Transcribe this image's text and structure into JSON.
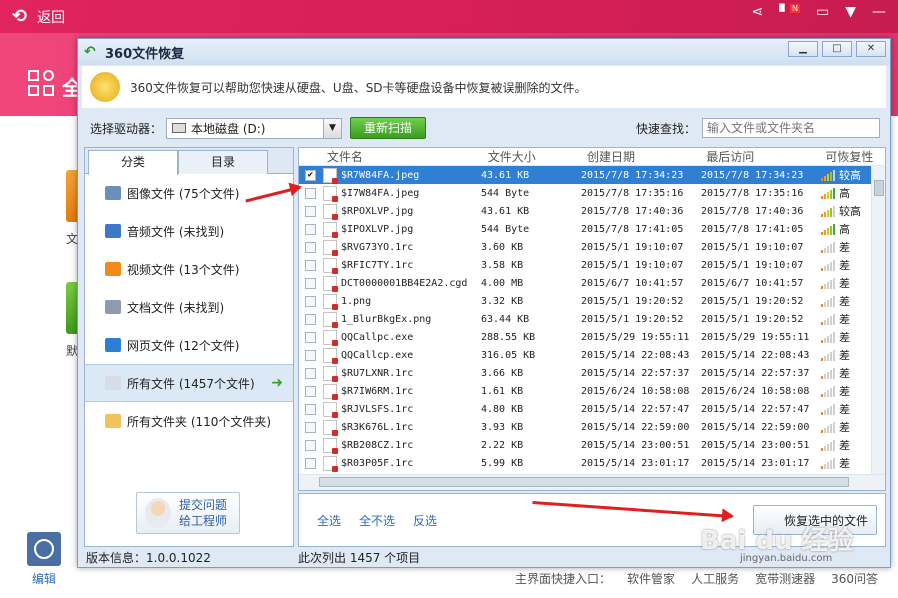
{
  "bg": {
    "back_label": "返回",
    "tile_char": "全",
    "left_item1_char": "文",
    "left_item2_char": "默",
    "edit_label": "编辑",
    "notif_badge": "N",
    "bottom_links": [
      "主界面快捷入口：",
      "软件管家",
      "人工服务",
      "宽带测速器",
      "360问答"
    ]
  },
  "window": {
    "title": "360文件恢复",
    "info_text": "360文件恢复可以帮助您快速从硬盘、U盘、SD卡等硬盘设备中恢复被误删除的文件。",
    "drive_label": "选择驱动器：",
    "drive_value": "本地磁盘 (D:)",
    "rescan_label": "重新扫描",
    "search_label": "快速查找：",
    "search_placeholder": "输入文件或文件夹名"
  },
  "left": {
    "tabs": [
      "分类",
      "目录"
    ],
    "categories": [
      {
        "label": "图像文件 (75个文件)",
        "icon": "image-icon",
        "color": "#6a8fb8"
      },
      {
        "label": "音频文件 (未找到)",
        "icon": "music-icon",
        "color": "#3f78c4"
      },
      {
        "label": "视频文件 (13个文件)",
        "icon": "video-icon",
        "color": "#f08a1c"
      },
      {
        "label": "文档文件 (未找到)",
        "icon": "document-icon",
        "color": "#8c9bb0"
      },
      {
        "label": "网页文件 (12个文件)",
        "icon": "ie-icon",
        "color": "#2d7fd6"
      },
      {
        "label": "所有文件 (1457个文件)",
        "icon": "all-files-icon",
        "color": "#d6dde6"
      },
      {
        "label": "所有文件夹 (110个文件夹)",
        "icon": "folder-icon",
        "color": "#f2c35a"
      }
    ],
    "feedback_line1": "提交问题",
    "feedback_line2": "给工程师"
  },
  "files": {
    "headers": [
      "文件名",
      "文件大小",
      "创建日期",
      "最后访问",
      "可恢复性"
    ],
    "rows": [
      {
        "name": "$R7W84FA.jpeg",
        "size": "43.61 KB",
        "created": "2015/7/8 17:34:23",
        "access": "2015/7/8 17:34:23",
        "rec": "较高",
        "level": 4,
        "checked": true
      },
      {
        "name": "$I7W84FA.jpeg",
        "size": "544 Byte",
        "created": "2015/7/8 17:35:16",
        "access": "2015/7/8 17:35:16",
        "rec": "高",
        "level": 5,
        "checked": false
      },
      {
        "name": "$RPOXLVP.jpg",
        "size": "43.61 KB",
        "created": "2015/7/8 17:40:36",
        "access": "2015/7/8 17:40:36",
        "rec": "较高",
        "level": 4,
        "checked": false
      },
      {
        "name": "$IPOXLVP.jpg",
        "size": "544 Byte",
        "created": "2015/7/8 17:41:05",
        "access": "2015/7/8 17:41:05",
        "rec": "高",
        "level": 5,
        "checked": false
      },
      {
        "name": "$RVG73YO.1rc",
        "size": "3.60 KB",
        "created": "2015/5/1 19:10:07",
        "access": "2015/5/1 19:10:07",
        "rec": "差",
        "level": 1,
        "checked": false
      },
      {
        "name": "$RFIC7TY.1rc",
        "size": "3.58 KB",
        "created": "2015/5/1 19:10:07",
        "access": "2015/5/1 19:10:07",
        "rec": "差",
        "level": 1,
        "checked": false
      },
      {
        "name": "DCT0000001BB4E2A2.cgd",
        "size": "4.00 MB",
        "created": "2015/6/7 10:41:57",
        "access": "2015/6/7 10:41:57",
        "rec": "差",
        "level": 1,
        "checked": false
      },
      {
        "name": "1.png",
        "size": "3.32 KB",
        "created": "2015/5/1 19:20:52",
        "access": "2015/5/1 19:20:52",
        "rec": "差",
        "level": 1,
        "checked": false
      },
      {
        "name": "1_BlurBkgEx.png",
        "size": "63.44 KB",
        "created": "2015/5/1 19:20:52",
        "access": "2015/5/1 19:20:52",
        "rec": "差",
        "level": 1,
        "checked": false
      },
      {
        "name": "QQCallpc.exe",
        "size": "288.55 KB",
        "created": "2015/5/29 19:55:11",
        "access": "2015/5/29 19:55:11",
        "rec": "差",
        "level": 1,
        "checked": false
      },
      {
        "name": "QQCallcp.exe",
        "size": "316.05 KB",
        "created": "2015/5/14 22:08:43",
        "access": "2015/5/14 22:08:43",
        "rec": "差",
        "level": 1,
        "checked": false
      },
      {
        "name": "$RU7LXNR.1rc",
        "size": "3.66 KB",
        "created": "2015/5/14 22:57:37",
        "access": "2015/5/14 22:57:37",
        "rec": "差",
        "level": 1,
        "checked": false
      },
      {
        "name": "$R7IW6RM.1rc",
        "size": "1.61 KB",
        "created": "2015/6/24 10:58:08",
        "access": "2015/6/24 10:58:08",
        "rec": "差",
        "level": 1,
        "checked": false
      },
      {
        "name": "$RJVLSFS.1rc",
        "size": "4.80 KB",
        "created": "2015/5/14 22:57:47",
        "access": "2015/5/14 22:57:47",
        "rec": "差",
        "level": 1,
        "checked": false
      },
      {
        "name": "$R3K676L.1rc",
        "size": "3.93 KB",
        "created": "2015/5/14 22:59:00",
        "access": "2015/5/14 22:59:00",
        "rec": "差",
        "level": 1,
        "checked": false
      },
      {
        "name": "$RB208CZ.1rc",
        "size": "2.22 KB",
        "created": "2015/5/14 23:00:51",
        "access": "2015/5/14 23:00:51",
        "rec": "差",
        "level": 1,
        "checked": false
      },
      {
        "name": "$R03P05F.1rc",
        "size": "5.99 KB",
        "created": "2015/5/14 23:01:17",
        "access": "2015/5/14 23:01:17",
        "rec": "差",
        "level": 1,
        "checked": false
      }
    ]
  },
  "actions": {
    "select_all": "全选",
    "select_none": "全不选",
    "invert": "反选",
    "recover": "恢复选中的文件"
  },
  "status": {
    "version": "版本信息：1.0.0.1022",
    "count": "此次列出 1457 个项目"
  },
  "watermark": {
    "brand": "Bai du 经验",
    "url": "jingyan.baidu.com"
  }
}
